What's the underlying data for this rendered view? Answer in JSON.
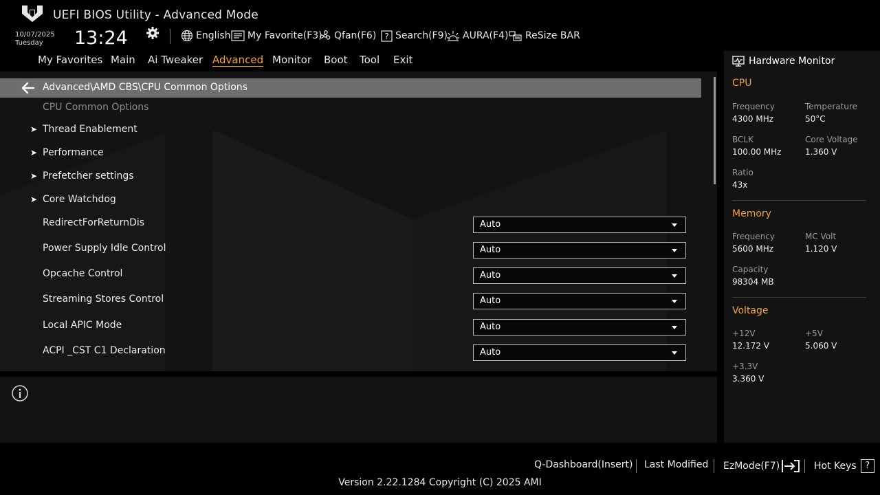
{
  "header": {
    "title": "UEFI BIOS Utility - Advanced Mode",
    "date": "10/07/2025",
    "day": "Tuesday",
    "time": "13:24",
    "tools": {
      "language": "English",
      "favorite": "My Favorite(F3)",
      "qfan": "Qfan(F6)",
      "search": "Search(F9)",
      "aura": "AURA(F4)",
      "resize_bar": "ReSize BAR"
    }
  },
  "menu": {
    "items": [
      "My Favorites",
      "Main",
      "Ai Tweaker",
      "Advanced",
      "Monitor",
      "Boot",
      "Tool",
      "Exit"
    ],
    "active": "Advanced"
  },
  "main": {
    "breadcrumb": "Advanced\\AMD CBS\\CPU Common Options",
    "section_title": "CPU Common Options",
    "submenus": [
      "Thread Enablement",
      "Performance",
      "Prefetcher settings",
      "Core Watchdog"
    ],
    "settings": [
      {
        "label": "RedirectForReturnDis",
        "value": "Auto"
      },
      {
        "label": "Power Supply Idle Control",
        "value": "Auto"
      },
      {
        "label": "Opcache Control",
        "value": "Auto"
      },
      {
        "label": "Streaming Stores Control",
        "value": "Auto"
      },
      {
        "label": "Local APIC Mode",
        "value": "Auto"
      },
      {
        "label": "ACPI _CST C1 Declaration",
        "value": "Auto"
      }
    ]
  },
  "hardware_monitor": {
    "title": "Hardware Monitor",
    "cpu": {
      "heading": "CPU",
      "frequency_label": "Frequency",
      "frequency": "4300 MHz",
      "temperature_label": "Temperature",
      "temperature": "50°C",
      "bclk_label": "BCLK",
      "bclk": "100.00 MHz",
      "core_voltage_label": "Core Voltage",
      "core_voltage": "1.360 V",
      "ratio_label": "Ratio",
      "ratio": "43x"
    },
    "memory": {
      "heading": "Memory",
      "frequency_label": "Frequency",
      "frequency": "5600 MHz",
      "mc_volt_label": "MC Volt",
      "mc_volt": "1.120 V",
      "capacity_label": "Capacity",
      "capacity": "98304 MB"
    },
    "voltage": {
      "heading": "Voltage",
      "v12_label": "+12V",
      "v12": "12.172 V",
      "v5_label": "+5V",
      "v5": "5.060 V",
      "v33_label": "+3.3V",
      "v33": "3.360 V"
    }
  },
  "footer": {
    "q_dashboard": "Q-Dashboard(Insert)",
    "last_modified": "Last Modified",
    "ezmode": "EzMode(F7)",
    "hot_keys": "Hot Keys",
    "hot_keys_icon": "?",
    "version": "Version 2.22.1284 Copyright (C) 2025 AMI"
  },
  "colors": {
    "accent": "#f7a33a",
    "section_heading": "#f0a23d",
    "panel_bg": "#131313",
    "breadcrumb_bg": "#6e6e6e"
  },
  "icons": [
    "tuf-logo-icon",
    "gear-icon",
    "globe-icon",
    "favorite-list-icon",
    "fan-icon",
    "search-help-icon",
    "aura-icon",
    "resize-bar-icon",
    "back-arrow-icon",
    "chevron-right-icon",
    "info-icon",
    "hardware-monitor-icon",
    "ezmode-exit-icon",
    "help-question-icon"
  ]
}
